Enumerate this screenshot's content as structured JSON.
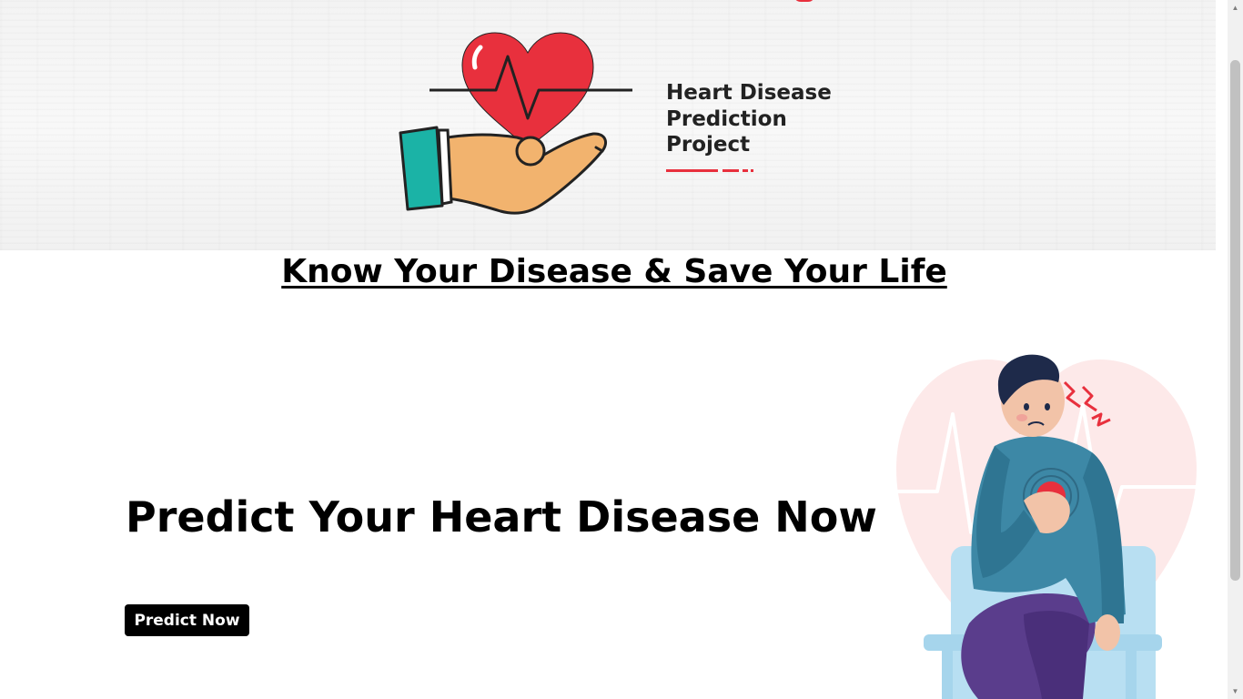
{
  "banner": {
    "title": "Heart Disease\nPrediction\nProject"
  },
  "tagline": "Know Your Disease & Save Your Life",
  "hero": {
    "headline": "Predict Your Heart Disease Now",
    "button_label": "Predict Now"
  },
  "icons": {
    "logo": "heart-in-hand-icon",
    "illustration": "man-chest-pain-illustration",
    "scroll_up": "scroll-up-arrow",
    "scroll_down": "scroll-down-arrow"
  },
  "colors": {
    "heart_red": "#e8303d",
    "sleeve_teal": "#1bb3a6",
    "sweater_blue": "#3d88a6",
    "pants_purple": "#5a3d8c",
    "chair_blue": "#b8dff2",
    "button_bg": "#000000"
  }
}
